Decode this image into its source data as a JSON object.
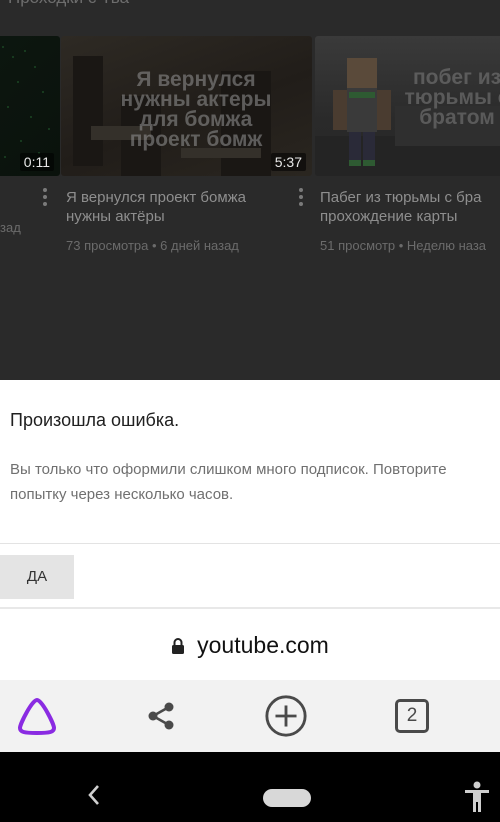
{
  "section": {
    "title": "Проходки с Тва"
  },
  "videos": [
    {
      "duration": "0:11",
      "title_line1": "",
      "title_line2": "",
      "meta": "зад",
      "thumb_text": ""
    },
    {
      "duration": "5:37",
      "title_line1": "Я вернулся проект бомжа",
      "title_line2": "нужны актёры",
      "meta": "73 просмотра • 6 дней назад",
      "thumb_text": "Я вернулся нужны актеры для бомжа проект бомж"
    },
    {
      "duration": "",
      "title_line1": "Пабег из тюрьмы с бра",
      "title_line2": "прохождение карты",
      "meta": "51 просмотр • Неделю наза",
      "thumb_text": "побег из тюрьмы с братом"
    }
  ],
  "dialog": {
    "title": "Произошла ошибка.",
    "body_line1": "Вы только что оформили слишком много подписок. Повторите",
    "body_line2": "попытку через несколько часов.",
    "button_label": "ДА"
  },
  "url_bar": {
    "url": "youtube.com"
  },
  "toolbar": {
    "tab_count": "2",
    "alice_color": "#8a2be2",
    "icon_color": "#4a4a4a"
  },
  "icons": {
    "lock": "lock-icon",
    "alice": "alice-assistant-icon",
    "share": "share-icon",
    "new_tab": "plus-circle-icon",
    "tabs": "tabs-counter-icon",
    "back": "chevron-left-icon",
    "home": "home-pill-icon",
    "accessibility": "accessibility-icon"
  }
}
